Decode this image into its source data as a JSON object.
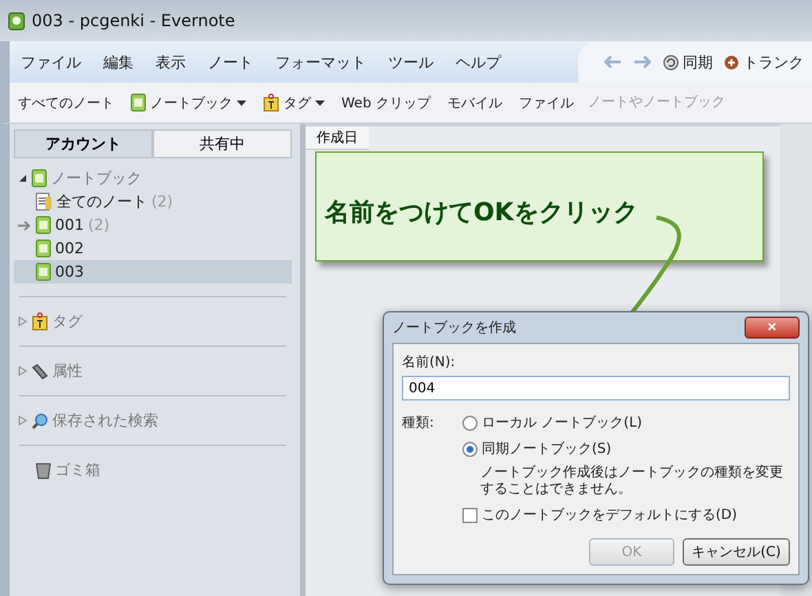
{
  "window": {
    "title": "003 - pcgenki - Evernote"
  },
  "menu": [
    "ファイル",
    "編集",
    "表示",
    "ノート",
    "フォーマット",
    "ツール",
    "ヘルプ"
  ],
  "nav": {
    "sync": "同期",
    "trunk": "トランク"
  },
  "toolbar": {
    "items": [
      {
        "label": "すべてのノート",
        "kind": "plain"
      },
      {
        "label": "ノートブック",
        "kind": "notebook"
      },
      {
        "label": "タグ",
        "kind": "tag"
      },
      {
        "label": "Web クリップ",
        "kind": "plain"
      },
      {
        "label": "モバイル",
        "kind": "plain"
      },
      {
        "label": "ファイル",
        "kind": "plain"
      }
    ],
    "search": {
      "placeholder": "ノートやノートブック"
    }
  },
  "sidebar": {
    "tabs": [
      {
        "label": "アカウント",
        "selected": true
      },
      {
        "label": "共有中",
        "selected": false
      }
    ],
    "notebooks": {
      "label": "ノートブック",
      "expanded": true,
      "children": [
        {
          "label": "全てのノート",
          "count": "(2)",
          "kind": "all",
          "selected": false,
          "current": false
        },
        {
          "label": "001",
          "count": "(2)",
          "kind": "notebook",
          "selected": false,
          "current": true
        },
        {
          "label": "002",
          "kind": "notebook",
          "selected": false,
          "current": false
        },
        {
          "label": "003",
          "kind": "notebook",
          "selected": true,
          "current": false
        }
      ]
    },
    "sections": [
      {
        "label": "タグ",
        "kind": "tag",
        "expanded": false
      },
      {
        "label": "属性",
        "kind": "attr",
        "expanded": false
      },
      {
        "label": "保存された検索",
        "kind": "search",
        "expanded": false
      }
    ],
    "trash": "ゴミ箱"
  },
  "list": {
    "columns": [
      "作成日"
    ]
  },
  "callout": "名前をつけてOKをクリック",
  "dialog": {
    "title": "ノートブックを作成",
    "close": "×",
    "name_label": "名前(N):",
    "name_value": "004",
    "type_label": "種類:",
    "options": [
      {
        "label": "ローカル ノートブック(L)",
        "selected": false
      },
      {
        "label": "同期ノートブック(S)",
        "selected": true
      }
    ],
    "note": "ノートブック作成後はノートブックの種類を変更することはできません。",
    "default_checkbox": {
      "label": "このノートブックをデフォルトにする(D)",
      "checked": false
    },
    "buttons": [
      {
        "label": "OK",
        "disabled": true
      },
      {
        "label": "キャンセル(C)",
        "disabled": false
      }
    ]
  }
}
